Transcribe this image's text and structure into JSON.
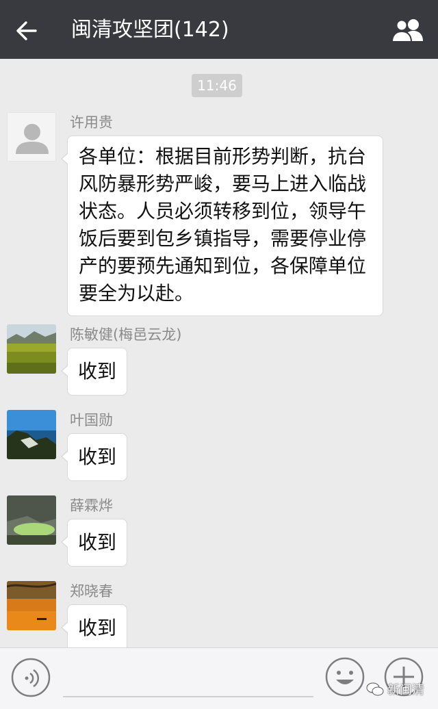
{
  "header": {
    "title": "闽清攻坚团(142)",
    "back_icon": "back-arrow-icon",
    "members_icon": "group-members-icon"
  },
  "chat": {
    "timestamp": "11:46",
    "messages": [
      {
        "sender": "许用贵",
        "text_lines": [
          "各单位：根据目前形势判断，抗台",
          "风防暴形势严峻，要马上进入临战",
          "状态。人员必须转移到位，领导午",
          "饭后要到包乡镇指导，需要停业停",
          "产的要预先通知到位，各保障单位",
          "要全为以赴。"
        ]
      },
      {
        "sender": "陈敏健(梅邑云龙)",
        "text": "收到"
      },
      {
        "sender": "叶国勋",
        "text": "收到"
      },
      {
        "sender": "薛霖烨",
        "text": "收到"
      },
      {
        "sender": "郑晓春",
        "text": "收到"
      }
    ]
  },
  "bottom_bar": {
    "voice_icon": "voice-icon",
    "emoji_icon": "emoji-icon",
    "plus_icon": "plus-icon"
  },
  "watermark": {
    "text": "新闽清"
  },
  "colors": {
    "header_bg": "#393a3f",
    "chat_bg": "#ebebeb",
    "bubble_bg": "#ffffff",
    "sender_text": "#8a8a8a"
  }
}
